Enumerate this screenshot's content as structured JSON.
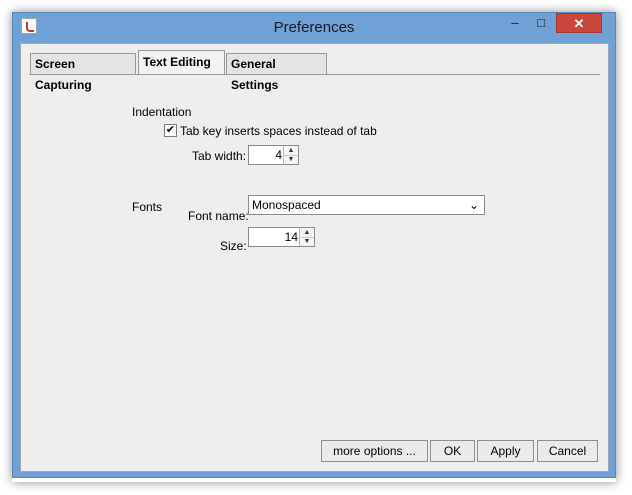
{
  "window": {
    "title": "Preferences",
    "minimize_label": "–",
    "maximize_label": "□",
    "close_label": "✕"
  },
  "tabs": [
    {
      "label": "Screen Capturing",
      "active": false
    },
    {
      "label": "Text Editing",
      "active": true
    },
    {
      "label": "General Settings",
      "active": false
    }
  ],
  "indentation": {
    "section_label": "Indentation",
    "tab_spaces_label": "Tab key inserts spaces instead of tab",
    "tab_spaces_checked": true,
    "check_mark": "✔",
    "tab_width_label": "Tab width:",
    "tab_width_value": "4"
  },
  "fonts": {
    "section_label": "Fonts",
    "font_name_label": "Font name:",
    "font_name_value": "Monospaced",
    "dropdown_arrow": "⌄",
    "size_label": "Size:",
    "size_value": "14"
  },
  "spinner_glyphs": {
    "up": "▲",
    "down": "▼"
  },
  "buttons": {
    "more_options": "more options ...",
    "ok": "OK",
    "apply": "Apply",
    "cancel": "Cancel"
  }
}
